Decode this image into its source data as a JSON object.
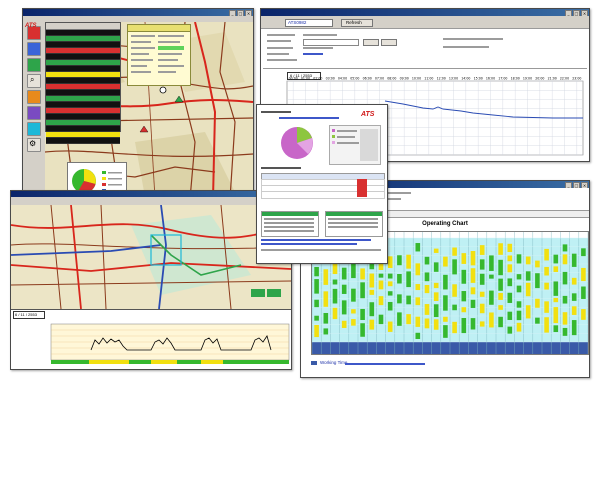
{
  "app": {
    "brand": "ATS"
  },
  "windows": {
    "map_main": {
      "title": ""
    },
    "speed_chart": {
      "title": "",
      "field_vehicle": "ATS0982",
      "field_button": "Refresh",
      "date_box": "6 / 11 / 2553",
      "time_ticks": [
        "00:00",
        "01:00",
        "02:00",
        "03:00",
        "04:00",
        "05:00",
        "06:00",
        "07:00",
        "08:00",
        "09:00",
        "10:00",
        "11:00",
        "12:00",
        "13:00",
        "14:00",
        "15:00",
        "16:00",
        "17:00",
        "18:00",
        "19:00",
        "20:00",
        "21:00",
        "22:00",
        "23:00"
      ]
    },
    "report": {
      "title": "",
      "brand": "ATS"
    },
    "map_second": {
      "title": "",
      "date_box": "6 / 11 / 2553"
    },
    "operating_chart": {
      "title": "Operating Chart",
      "footer": "Working Time"
    }
  },
  "colors": {
    "map_bg": "#efe9cf",
    "road_red": "#d8261c",
    "road_brown": "#8b3a1c",
    "road_blue": "#2a4bb3",
    "chart_green": "#36b82e",
    "chart_yellow": "#f2e010",
    "chart_blue": "#3a5aa8",
    "grid_cyan": "#a8e6ee"
  }
}
